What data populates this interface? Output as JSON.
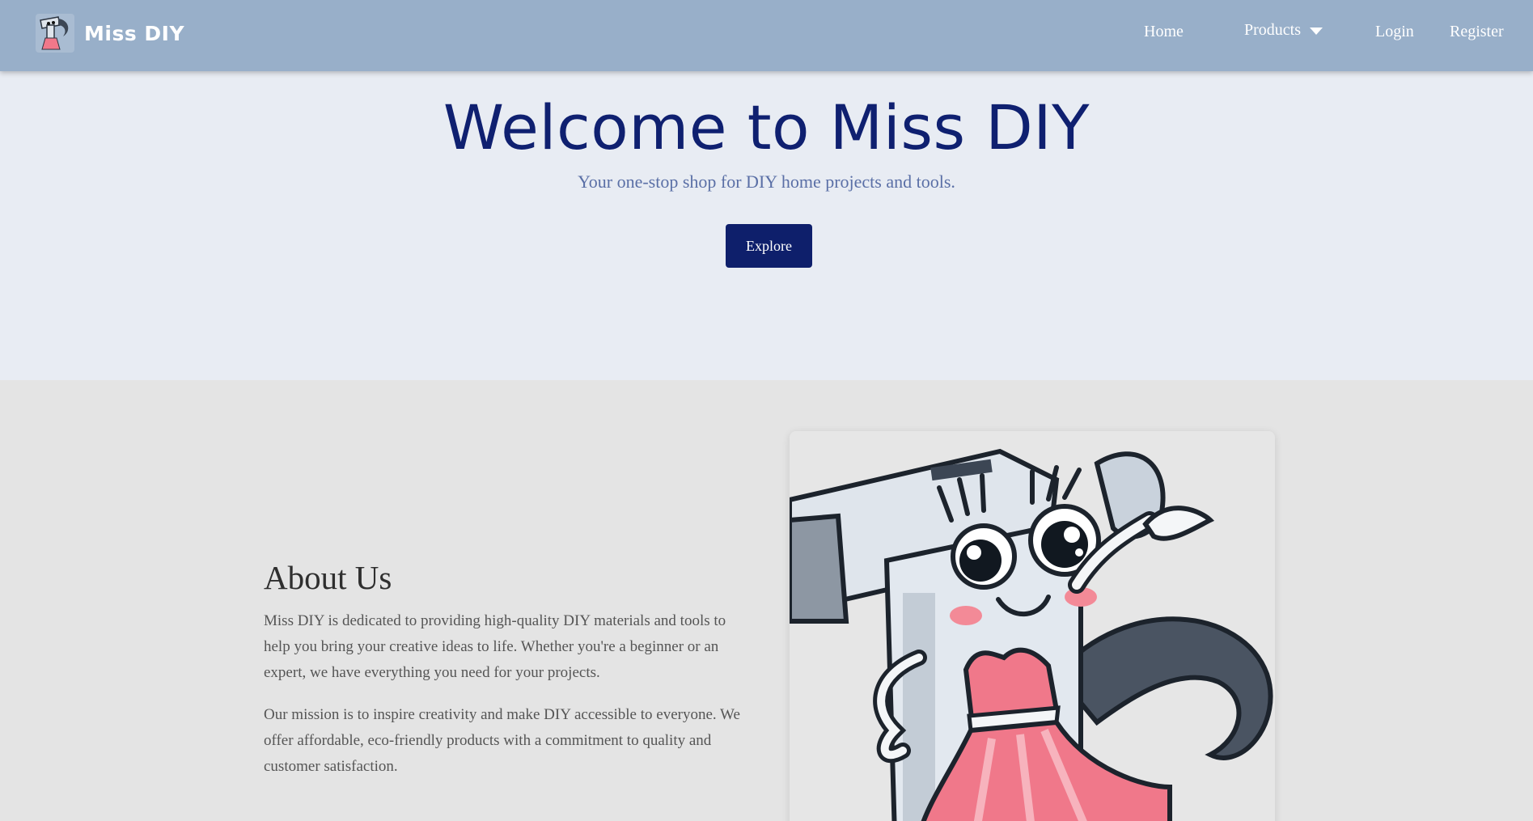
{
  "nav": {
    "brand": "Miss DIY",
    "links": {
      "home": "Home",
      "products": "Products",
      "login": "Login",
      "register": "Register"
    }
  },
  "hero": {
    "title": "Welcome to Miss DIY",
    "subtitle": "Your one-stop shop for DIY home projects and tools.",
    "cta": "Explore"
  },
  "about": {
    "title": "About Us",
    "paragraphs": [
      "Miss DIY is dedicated to providing high-quality DIY materials and tools to help you bring your creative ideas to life. Whether you're a beginner or an expert, we have everything you need for your projects.",
      "Our mission is to inspire creativity and make DIY accessible to everyone. We offer affordable, eco-friendly products with a commitment to quality and customer satisfaction."
    ]
  },
  "colors": {
    "navbar": "#98afc9",
    "hero_bg": "#e8ecf3",
    "primary": "#0e1f6b",
    "about_bg": "#e4e4e4",
    "dress_pink": "#f0788a"
  },
  "icons": {
    "logo": "hammer-mascot-logo",
    "products_caret": "caret-down-icon",
    "about_image": "hammer-mascot-illustration"
  }
}
